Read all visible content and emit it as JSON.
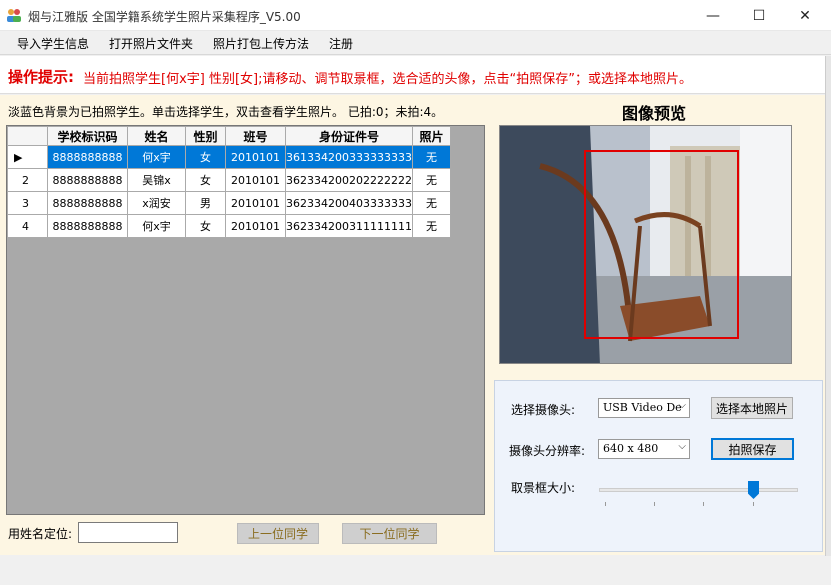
{
  "window": {
    "title": "烟与江雅版 全国学籍系统学生照片采集程序_V5.00",
    "minimize": "—",
    "maximize": "☐",
    "close": "✕"
  },
  "menu": {
    "items": [
      "导入学生信息",
      "打开照片文件夹",
      "照片打包上传方法",
      "注册"
    ]
  },
  "hint": {
    "label": "操作提示:",
    "text": "当前拍照学生[何x宇] 性别[女];请移动、调节取景框，选合适的头像，点击“拍照保存”；或选择本地照片。"
  },
  "status_note": "淡蓝色背景为已拍照学生。单击选择学生，双击查看学生照片。 已拍:0；未拍:4。",
  "table": {
    "columns": [
      "学校标识码",
      "姓名",
      "性别",
      "班号",
      "身份证件号",
      "照片"
    ],
    "rows": [
      {
        "num": "",
        "school_id": "8888888888",
        "name": "何x宇",
        "gender": "女",
        "class": "2010101",
        "id_no": "361334200333333333",
        "photo": "无"
      },
      {
        "num": "2",
        "school_id": "8888888888",
        "name": "吴锦x",
        "gender": "女",
        "class": "2010101",
        "id_no": "362334200202222222",
        "photo": "无"
      },
      {
        "num": "3",
        "school_id": "8888888888",
        "name": "x润安",
        "gender": "男",
        "class": "2010101",
        "id_no": "362334200403333333",
        "photo": "无"
      },
      {
        "num": "4",
        "school_id": "8888888888",
        "name": "何x宇",
        "gender": "女",
        "class": "2010101",
        "id_no": "362334200311111111",
        "photo": "无"
      }
    ]
  },
  "preview": {
    "title": "图像预览"
  },
  "controls": {
    "camera_label": "选择摄像头:",
    "camera_value": "USB Video De",
    "local_photo_button": "选择本地照片",
    "resolution_label": "摄像头分辨率:",
    "resolution_value": "640 x 480",
    "save_button": "拍照保存",
    "frame_size_label": "取景框大小:",
    "frame_size_level": 0.78
  },
  "bottom": {
    "locate_label": "用姓名定位:",
    "locate_value": "",
    "prev_button": "上一位同学",
    "next_button": "下一位同学"
  },
  "colors": {
    "hint_red": "#e00000",
    "selected_row": "#0078d7",
    "crop_frame": "#e00000"
  }
}
